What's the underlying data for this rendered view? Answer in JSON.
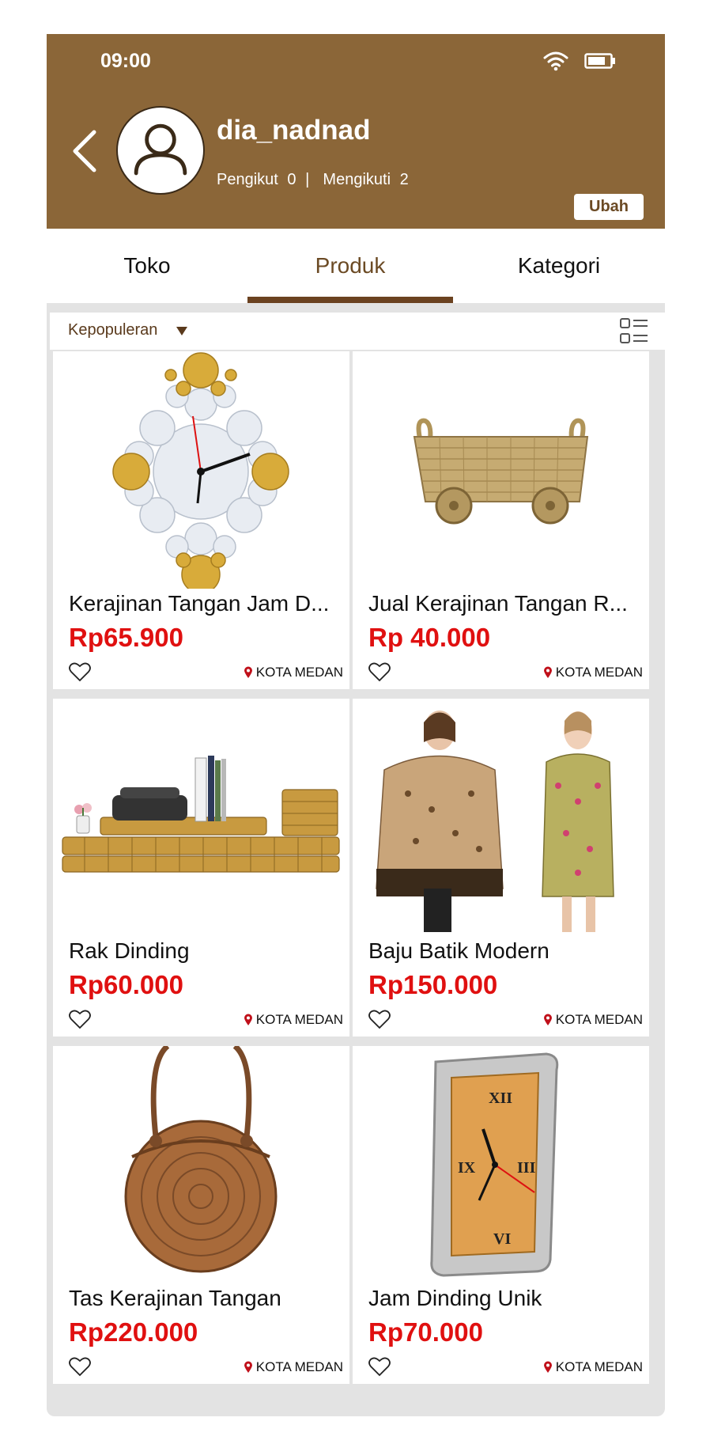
{
  "status": {
    "time": "09:00"
  },
  "profile": {
    "username": "dia_nadnad",
    "followers_label": "Pengikut",
    "followers_count": "0",
    "separator": "|",
    "following_label": "Mengikuti",
    "following_count": "2",
    "edit_label": "Ubah"
  },
  "tabs": [
    {
      "label": "Toko"
    },
    {
      "label": "Produk",
      "active": true
    },
    {
      "label": "Kategori"
    }
  ],
  "sort": {
    "label": "Kepopuleran"
  },
  "products": [
    {
      "title": "Kerajinan Tangan Jam D...",
      "price": "Rp65.900",
      "location": "KOTA MEDAN",
      "image": "wall-clock-paper-craft"
    },
    {
      "title": "Jual Kerajinan Tangan R...",
      "price": "Rp 40.000",
      "location": "KOTA MEDAN",
      "image": "rattan-basket-cart"
    },
    {
      "title": "Rak Dinding",
      "price": "Rp60.000",
      "location": "KOTA MEDAN",
      "image": "wooden-wall-shelf"
    },
    {
      "title": "Baju Batik Modern",
      "price": "Rp150.000",
      "location": "KOTA MEDAN",
      "image": "batik-dresses"
    },
    {
      "title": "Tas Kerajinan Tangan",
      "price": "Rp220.000",
      "location": "KOTA MEDAN",
      "image": "round-rattan-bag"
    },
    {
      "title": "Jam Dinding Unik",
      "price": "Rp70.000",
      "location": "KOTA MEDAN",
      "image": "square-wall-clock"
    }
  ],
  "colors": {
    "header": "#8b6638",
    "accent": "#6b4220",
    "price": "#e01010"
  }
}
